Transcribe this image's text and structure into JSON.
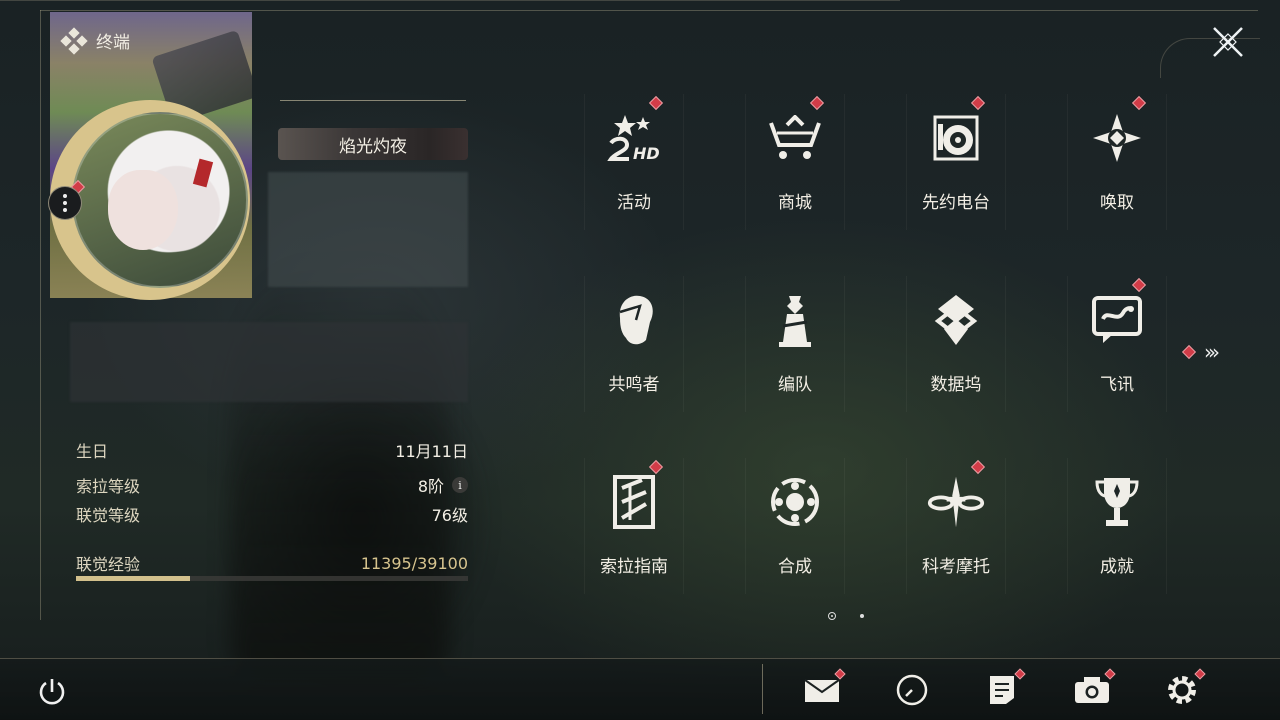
{
  "header": {
    "title": "终端"
  },
  "profile": {
    "title_badge": "焰光灼夜",
    "stats": [
      {
        "label": "生日",
        "value": "11月11日"
      },
      {
        "label": "索拉等级",
        "value": "8阶"
      },
      {
        "label": "联觉等级",
        "value": "76级"
      }
    ],
    "exp": {
      "label": "联觉经验",
      "value": "11395/39100",
      "progress": 0.291
    }
  },
  "menu": [
    {
      "label": "活动",
      "icon": "event-2hd-icon",
      "notify": true
    },
    {
      "label": "商城",
      "icon": "shop-cart-icon",
      "notify": true
    },
    {
      "label": "先约电台",
      "icon": "radio-record-icon",
      "notify": true
    },
    {
      "label": "唤取",
      "icon": "convene-compass-icon",
      "notify": true
    },
    {
      "label": "共鸣者",
      "icon": "resonator-head-icon",
      "notify": false
    },
    {
      "label": "编队",
      "icon": "team-chess-icon",
      "notify": false
    },
    {
      "label": "数据坞",
      "icon": "data-bank-icon",
      "notify": false
    },
    {
      "label": "飞讯",
      "icon": "message-chat-icon",
      "notify": true
    },
    {
      "label": "索拉指南",
      "icon": "guidebook-icon",
      "notify": true
    },
    {
      "label": "合成",
      "icon": "synthesis-orbit-icon",
      "notify": false
    },
    {
      "label": "科考摩托",
      "icon": "motorcycle-icon",
      "notify": true
    },
    {
      "label": "成就",
      "icon": "trophy-icon",
      "notify": false
    }
  ],
  "pager": {
    "current": 1,
    "total": 2
  },
  "bottom_tools": [
    {
      "name": "mail",
      "icon": "mail-icon",
      "notify": true
    },
    {
      "name": "clock",
      "icon": "clock-icon",
      "notify": false
    },
    {
      "name": "notice",
      "icon": "notice-icon",
      "notify": true
    },
    {
      "name": "camera",
      "icon": "camera-icon",
      "notify": true
    },
    {
      "name": "settings",
      "icon": "gear-icon",
      "notify": true
    }
  ],
  "colors": {
    "accent": "#d2c08c",
    "notify": "#d23c48",
    "text": "#f2eee4"
  }
}
